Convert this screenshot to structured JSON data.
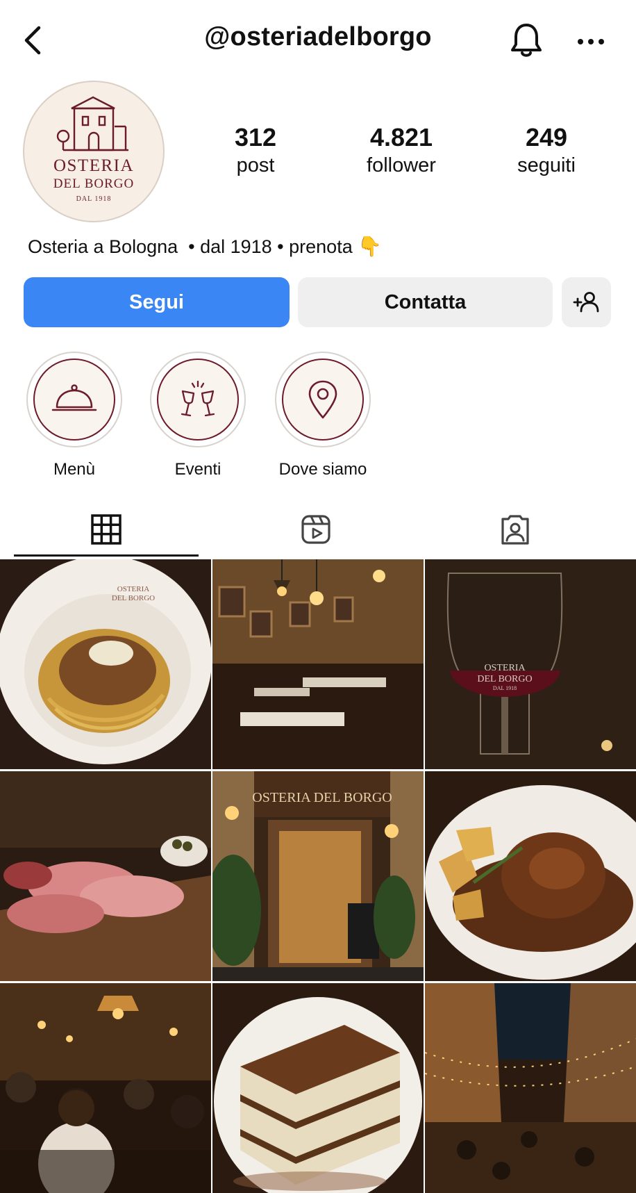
{
  "header": {
    "username": "@osteriadelborgo",
    "back_icon": "chevron-left-icon",
    "bell_icon": "bell-icon",
    "more_icon": "more-horizontal-icon"
  },
  "profile": {
    "avatar_logo": {
      "line1": "OSTERIA",
      "line2": "DEL BORGO",
      "line3": "DAL 1918"
    },
    "stats": [
      {
        "value": "312",
        "label": "post"
      },
      {
        "value": "4.821",
        "label": "follower"
      },
      {
        "value": "249",
        "label": "seguiti"
      }
    ],
    "bio": {
      "text": "Osteria a Bologna  • dal 1918 • prenota",
      "emoji": "👇"
    }
  },
  "actions": {
    "follow_label": "Segui",
    "contact_label": "Contatta",
    "add_user_icon": "add-user-icon"
  },
  "highlights": [
    {
      "label": "Menù",
      "icon": "cloche-icon"
    },
    {
      "label": "Eventi",
      "icon": "wine-glasses-icon"
    },
    {
      "label": "Dove siamo",
      "icon": "location-pin-icon"
    }
  ],
  "tabs": [
    {
      "icon": "grid-icon",
      "active": true
    },
    {
      "icon": "reels-icon",
      "active": false
    },
    {
      "icon": "tagged-icon",
      "active": false
    }
  ],
  "posts": [
    {
      "subject": "pasta-dish",
      "plate_text_1": "OSTERIA",
      "plate_text_2": "DEL BORGO"
    },
    {
      "subject": "dining-room"
    },
    {
      "subject": "wine-glass",
      "glass_text_1": "OSTERIA",
      "glass_text_2": "DEL BORGO",
      "glass_text_3": "DAL 1918"
    },
    {
      "subject": "cured-meats"
    },
    {
      "subject": "storefront",
      "sign_text": "OSTERIA DEL BORGO"
    },
    {
      "subject": "braised-meat"
    },
    {
      "subject": "crowded-interior"
    },
    {
      "subject": "tiramisu"
    },
    {
      "subject": "street-at-night"
    }
  ],
  "colors": {
    "accent_blue": "#3a86f4",
    "brand_burgundy": "#6c1b2a",
    "button_gray": "#efefef"
  }
}
